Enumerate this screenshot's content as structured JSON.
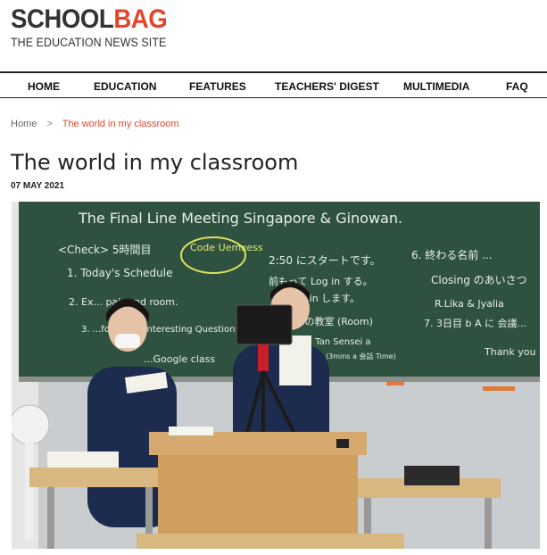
{
  "site": {
    "logo_part1": "SCHOOL",
    "logo_part2": "BAG",
    "tagline": "THE EDUCATION NEWS SITE"
  },
  "nav": {
    "items": [
      "HOME",
      "EDUCATION",
      "FEATURES",
      "TEACHERS' DIGEST",
      "MULTIMEDIA",
      "FAQ"
    ]
  },
  "breadcrumb": {
    "home": "Home",
    "separator": ">",
    "current": "The world in my classroom"
  },
  "article": {
    "title": "The world in my classroom",
    "date": "07 MAY 2021",
    "photo": {
      "board_title": "The Final Line Meeting Singapore & Ginowan.",
      "board_lines": [
        "<Check> 5時間目",
        "Code Uemxess",
        "2:50 にスタートです。",
        "1. Today's Schedule",
        "前もって Log in する。",
        "2. Ex... pair and room.",
        "...Log in します。",
        "3. ...for Some interesting Questions",
        "...の教室 (Room)",
        "Mr. Tan Sensei a",
        "...Google class",
        "(3mins a 会話 Time)",
        "6. 終わる名前 ...",
        "Closing のあいさつ",
        "R.Lika & Jyalia",
        "7. 3日目 b A に 会議...",
        "Thank you"
      ]
    }
  },
  "colors": {
    "brand": "#e2452d",
    "text": "#222222",
    "board": "#2f5240"
  }
}
